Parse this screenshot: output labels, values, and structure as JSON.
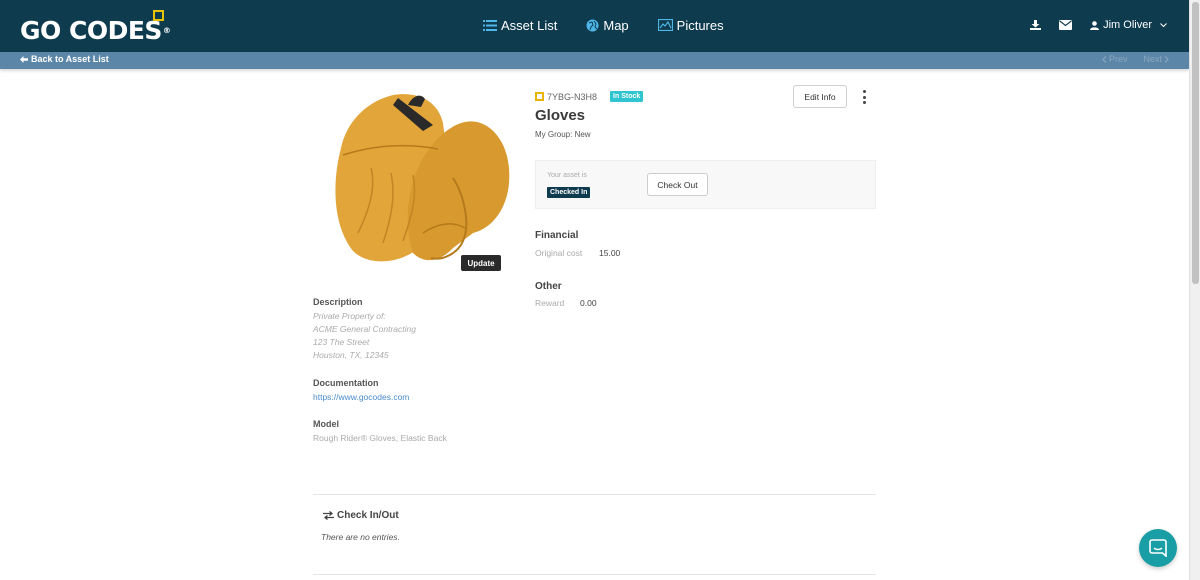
{
  "brand": {
    "logo_text": "GO CODES",
    "accent": "#e9c200",
    "nav_bg": "#0f3b4f",
    "subbar_bg": "#5b86a8"
  },
  "nav": {
    "items": [
      {
        "label": "Asset List",
        "icon": "list-icon"
      },
      {
        "label": "Map",
        "icon": "globe-icon"
      },
      {
        "label": "Pictures",
        "icon": "picture-icon"
      }
    ],
    "icons": [
      "download-icon",
      "envelope-icon"
    ],
    "user_name": "Jim Oliver"
  },
  "subbar": {
    "back_label": "Back to Asset List",
    "prev_label": "Prev",
    "next_label": "Next"
  },
  "asset": {
    "code": "7YBG-N3H8",
    "status_badge": "In Stock",
    "title": "Gloves",
    "group": "My Group: New",
    "edit_label": "Edit Info",
    "update_label": "Update",
    "checkin": {
      "prompt": "Your asset is",
      "state": "Checked In",
      "action_label": "Check Out"
    },
    "financial": {
      "heading": "Financial",
      "key": "Original cost",
      "value": "15.00"
    },
    "other": {
      "heading": "Other",
      "key": "Reward",
      "value": "0.00"
    },
    "description": {
      "label": "Description",
      "lines": [
        "Private Property of:",
        "ACME General Contracting",
        "123 The Street",
        "Houston, TX, 12345"
      ]
    },
    "documentation": {
      "label": "Documentation",
      "url": "https://www.gocodes.com"
    },
    "model": {
      "label": "Model",
      "value": "Rough Rider® Gloves, Elastic Back"
    }
  },
  "checkinout": {
    "heading": "Check In/Out",
    "empty_text": "There are no entries."
  },
  "colors": {
    "in_stock": "#2ec4d0",
    "checked_in": "#0f3b4f",
    "chat": "#1a9ea6",
    "link": "#4a8ac9"
  }
}
